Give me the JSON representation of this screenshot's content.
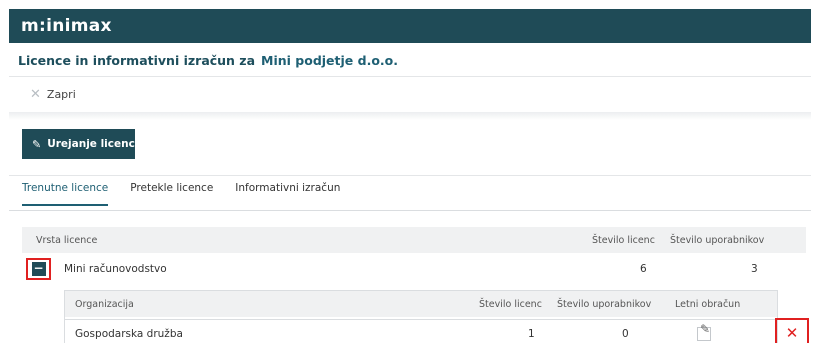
{
  "app": {
    "logo": "m:inimax"
  },
  "header": {
    "title": "Licence in informativni izračun za",
    "company": "Mini podjetje d.o.o."
  },
  "toolbar": {
    "close_label": "Zapri",
    "edit_label": "Urejanje licenc"
  },
  "tabs": [
    {
      "label": "Trenutne licence",
      "active": true
    },
    {
      "label": "Pretekle licence",
      "active": false
    },
    {
      "label": "Informativni izračun",
      "active": false
    }
  ],
  "licenses_table": {
    "columns": [
      "Vrsta licence",
      "Število licenc",
      "Število uporabnikov"
    ],
    "rows": [
      {
        "type": "Mini računovodstvo",
        "licenses": "6",
        "users": "3",
        "expanded": true
      }
    ]
  },
  "org_table": {
    "columns": [
      "Organizacija",
      "Število licenc",
      "Število uporabnikov",
      "Letni obračun"
    ],
    "rows": [
      {
        "organization": "Gospodarska družba",
        "licenses": "1",
        "users": "0",
        "annual": false
      }
    ]
  },
  "icons": {
    "close": "close-icon",
    "edit": "pencil-icon",
    "collapse": "minus-icon",
    "delete": "delete-icon"
  },
  "colors": {
    "brand": "#1f4b57",
    "accent": "#1e5f73",
    "highlight": "#e02020"
  }
}
